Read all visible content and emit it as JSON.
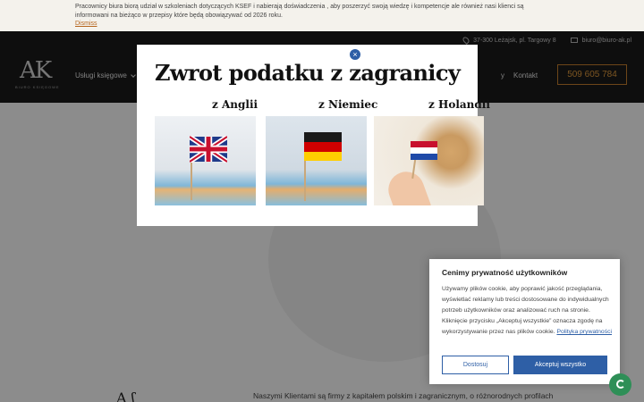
{
  "notice": {
    "text": "Pracownicy biura biorą udział w szkoleniach dotyczących KSEF i nabierają doświadczenia , aby poszerzyć swoją wiedzę i kompetencje ale również nasi klienci są informowani na bieżąco w przepisy które będą obowiązywać od 2026 roku.",
    "dismiss": "Dismiss"
  },
  "header": {
    "address": "37-300 Leżajsk, pl. Targowy 8",
    "email": "biuro@biuro-ak.pl",
    "logo_text": "AK",
    "logo_sub": "BIURO KSIĘGOWE",
    "nav_services": "Usługi księgowe",
    "nav_partial": "y",
    "nav_contact": "Kontakt",
    "phone": "509 605 784"
  },
  "modal": {
    "title": "Zwrot podatku z zagranicy",
    "close": "×",
    "countries": [
      {
        "label": "z Anglii"
      },
      {
        "label": "z Niemiec"
      },
      {
        "label": "z Holandii"
      }
    ]
  },
  "content": {
    "about_text": "Naszymi Klientami są firmy z kapitałem polskim i zagranicznym, o różnorodnych profilach",
    "signature": "A   ʃ"
  },
  "cookie": {
    "title": "Cenimy prywatność użytkowników",
    "text": "Używamy plików cookie, aby poprawić jakość przeglądania, wyświetlać reklamy lub treści dostosowane do indywidualnych potrzeb użytkowników oraz analizować ruch na stronie. Kliknięcie przycisku „Akceptuj wszystkie” oznacza zgodę na wykorzystywanie przez nas plików cookie.",
    "link": "Polityka prywatności",
    "customize": "Dostosuj",
    "accept": "Akceptuj wszystko"
  },
  "colors": {
    "accent": "#2e5fa6",
    "phone_accent": "#e09a3c",
    "header_bg": "#1b1b1b"
  }
}
